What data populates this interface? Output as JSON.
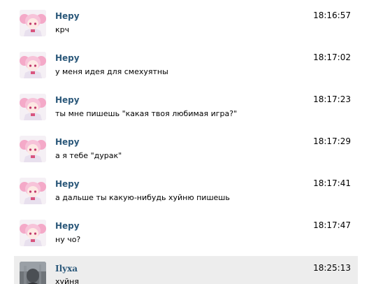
{
  "messages": [
    {
      "author": "Неру",
      "text": "крч",
      "time": "18:16:57",
      "avatar": "anime-pink-hair-avatar-icon"
    },
    {
      "author": "Неру",
      "text": "у меня идея для смехуятны",
      "time": "18:17:02",
      "avatar": "anime-pink-hair-avatar-icon"
    },
    {
      "author": "Неру",
      "text": "ты мне пишешь \"какая твоя любимая игра?\"",
      "time": "18:17:23",
      "avatar": "anime-pink-hair-avatar-icon"
    },
    {
      "author": "Неру",
      "text": "а я тебе \"дурак\"",
      "time": "18:17:29",
      "avatar": "anime-pink-hair-avatar-icon"
    },
    {
      "author": "Неру",
      "text": "а дальше ты какую-нибудь хуйню пишешь",
      "time": "18:17:41",
      "avatar": "anime-pink-hair-avatar-icon"
    },
    {
      "author": "Неру",
      "text": "ну чо?",
      "time": "18:17:47",
      "avatar": "anime-pink-hair-avatar-icon"
    },
    {
      "author": "Ilyxa",
      "text": "хуйня",
      "time": "18:25:13",
      "avatar": "grey-photo-avatar-icon"
    }
  ],
  "colors": {
    "author": "#2b587a",
    "highlight_bg": "#ededed"
  }
}
